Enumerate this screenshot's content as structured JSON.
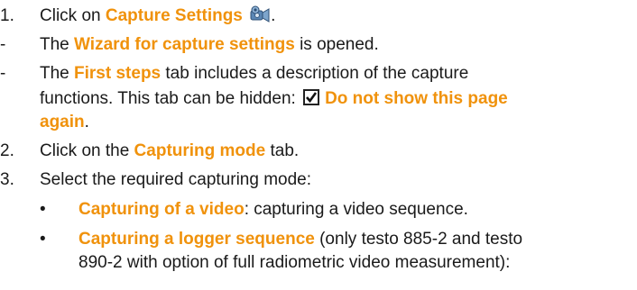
{
  "steps": [
    {
      "marker": "1.",
      "pre": "Click on ",
      "hl": "Capture Settings",
      "post": "."
    },
    {
      "marker": "-",
      "pre": "The ",
      "hl": "Wizard for capture settings",
      "post": " is opened."
    },
    {
      "marker": "-",
      "pre": "The ",
      "hl": "First steps",
      "post": " tab includes a description of the capture"
    },
    {
      "line2_pre": "functions. This tab can be hidden: ",
      "line2_hl": "Do not show this page",
      "line3_hl": "again",
      "line3_post": "."
    },
    {
      "marker": "2.",
      "pre": "Click on the ",
      "hl": "Capturing mode",
      "post": " tab."
    },
    {
      "marker": "3.",
      "pre": "Select the required capturing mode:"
    }
  ],
  "sub_items": [
    {
      "marker": "•",
      "hl": "Capturing of a video",
      "post": ": capturing a video sequence."
    },
    {
      "marker": "•",
      "hl": "Capturing a logger sequence",
      "post": " (only testo 885-2 and testo",
      "line2": "890-2 with option of full radiometric video measurement):"
    }
  ],
  "icons": {
    "capture_settings": "video-camera-icon",
    "checkbox": "checkbox-checked-icon"
  },
  "colors": {
    "highlight": "#f0920c",
    "text": "#1a1a1a"
  }
}
